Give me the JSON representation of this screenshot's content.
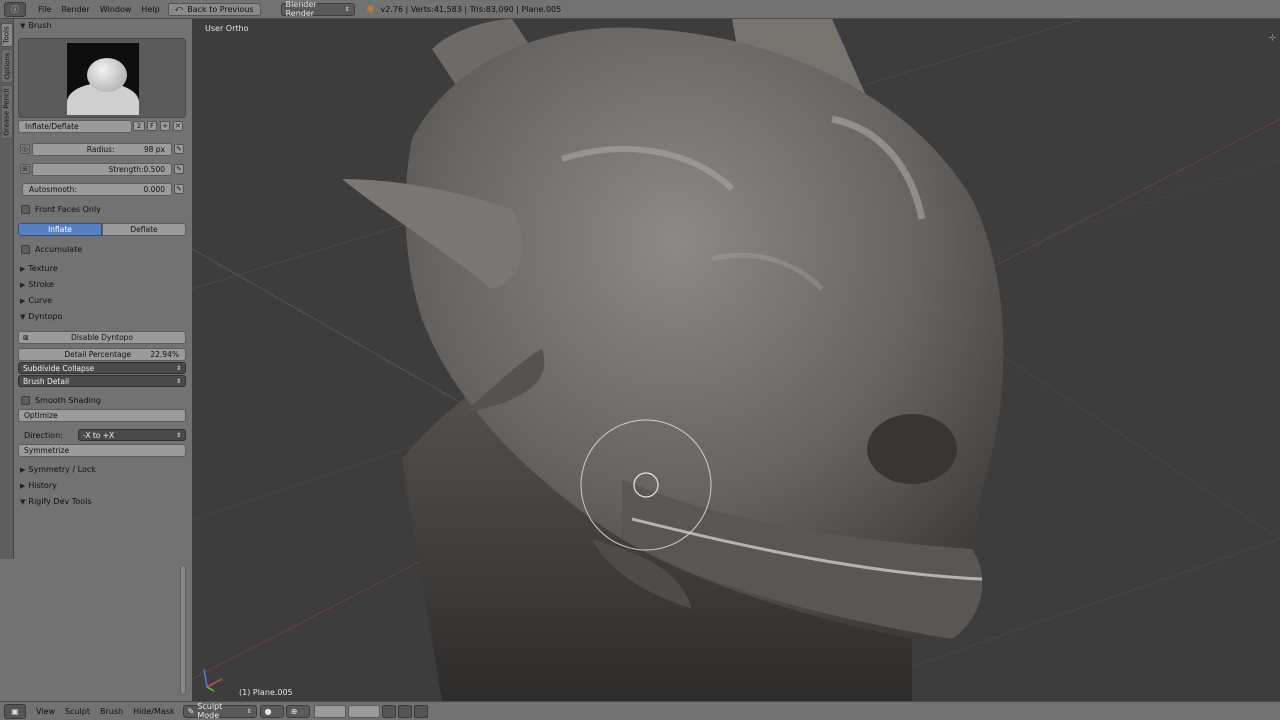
{
  "header": {
    "menus": [
      "File",
      "Render",
      "Window",
      "Help"
    ],
    "back_button": "Back to Previous",
    "render_engine": "Blender Render",
    "stats": "v2.76 | Verts:41,583 | Tris:83,090 | Plane.005"
  },
  "tool_tabs": [
    "Tools",
    "Options",
    "Grease Pencil"
  ],
  "brush": {
    "section": "Brush",
    "name": "Inflate/Deflate",
    "users": "2",
    "fake_user": "F",
    "radius_label": "Radius:",
    "radius_value": "98 px",
    "strength_label": "Strength:",
    "strength_value": "0.500",
    "strength_fraction": 0.5,
    "autosmooth_label": "Autosmooth:",
    "autosmooth_value": "0.000",
    "front_faces_only": "Front Faces Only",
    "inflate": "Inflate",
    "deflate": "Deflate",
    "accumulate": "Accumulate"
  },
  "panels": {
    "texture": "Texture",
    "stroke": "Stroke",
    "curve": "Curve",
    "dyntopo": "Dyntopo",
    "symmetry": "Symmetry / Lock",
    "history": "History",
    "rigify": "Rigify Dev Tools"
  },
  "dyntopo": {
    "disable_button": "Disable Dyntopo",
    "detail_label": "Detail Percentage",
    "detail_value": "22.94%",
    "detail_fraction": 0.2294,
    "method": "Subdivide Collapse",
    "detail_type": "Brush Detail",
    "smooth_shading": "Smooth Shading",
    "optimize": "Optimize",
    "direction_label": "Direction:",
    "direction_value": "-X to +X",
    "symmetrize": "Symmetrize"
  },
  "viewport": {
    "view_label": "User Ortho",
    "object_label": "(1) Plane.005"
  },
  "footer": {
    "menus": [
      "View",
      "Sculpt",
      "Brush",
      "Hide/Mask"
    ],
    "mode": "Sculpt Mode"
  },
  "colors": {
    "selected_button": "#5680c2",
    "panel_bg": "#727272",
    "viewport_bg": "#3d3d3d"
  }
}
